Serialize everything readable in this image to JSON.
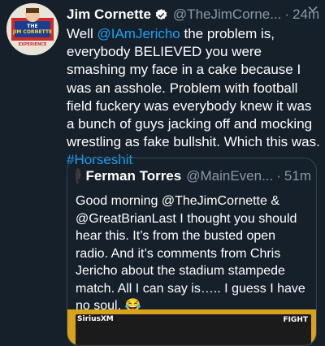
{
  "tweet": {
    "author_name": "Jim Cornette",
    "author_handle": "@TheJimCorne...",
    "separator": "·",
    "time": "24m",
    "text": {
      "part1": "Well ",
      "mention": "@IAmJericho",
      "part2": " the problem is, everybody BELIEVED you were smashing my face in a cake because I was an asshole. Problem with football field fuckery was everybody knew it was a bunch of guys jacking off and mocking wrestling as fake bullshit. Which this was. ",
      "hashtag": "#Horseshit"
    },
    "avatar_text": [
      "THE",
      "JIM CORNETTE",
      "EXPERIENCE"
    ]
  },
  "quoted_tweet": {
    "author_name": "Ferman Torres",
    "author_handle": "@MainEven...",
    "separator": "·",
    "time": "51m",
    "text": "Good morning @TheJimCornette & @GreatBrianLast I thought you should hear this. It’s from the busted open radio. And it’s comments from Chris Jericho about the stadium stampede match. All I can say is….. I guess I have no soul. 😂",
    "media_labels": [
      "SiriusXM",
      "FIGHT"
    ]
  },
  "colors": {
    "background": "#15202b",
    "accent": "#1da1f2",
    "muted": "#8899a6",
    "border": "#38444d"
  }
}
